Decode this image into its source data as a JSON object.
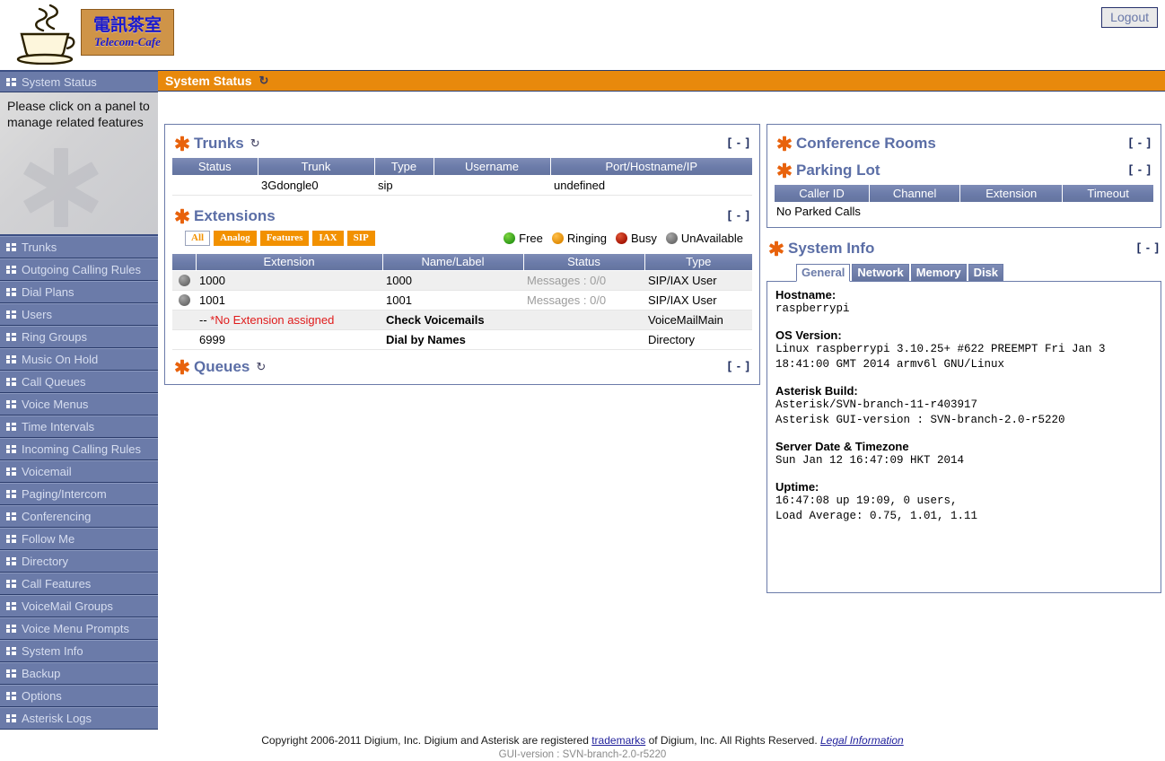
{
  "header": {
    "logo_cn": "電訊茶室",
    "logo_en": "Telecom-Cafe",
    "logo_icon": "coffee-cup-icon",
    "logout_label": "Logout"
  },
  "sidebar": {
    "active_item": "System Status",
    "panel_hint": "Please click on a panel to manage related features",
    "items": [
      {
        "label": "System Status"
      },
      {
        "label": "Trunks"
      },
      {
        "label": "Outgoing Calling Rules"
      },
      {
        "label": "Dial Plans"
      },
      {
        "label": "Users"
      },
      {
        "label": "Ring Groups"
      },
      {
        "label": "Music On Hold"
      },
      {
        "label": "Call Queues"
      },
      {
        "label": "Voice Menus"
      },
      {
        "label": "Time Intervals"
      },
      {
        "label": "Incoming Calling Rules"
      },
      {
        "label": "Voicemail"
      },
      {
        "label": "Paging/Intercom"
      },
      {
        "label": "Conferencing"
      },
      {
        "label": "Follow Me"
      },
      {
        "label": "Directory"
      },
      {
        "label": "Call Features"
      },
      {
        "label": "VoiceMail Groups"
      },
      {
        "label": "Voice Menu Prompts"
      },
      {
        "label": "System Info"
      },
      {
        "label": "Backup"
      },
      {
        "label": "Options"
      },
      {
        "label": "Asterisk Logs"
      }
    ]
  },
  "titlebar": {
    "title": "System Status",
    "refresh_icon": "↻"
  },
  "collapse_label": "[ - ]",
  "trunks": {
    "title": "Trunks",
    "refresh_icon": "↻",
    "columns": [
      "Status",
      "Trunk",
      "Type",
      "Username",
      "Port/Hostname/IP"
    ],
    "rows": [
      {
        "status": "",
        "trunk": "3Gdongle0",
        "type": "sip",
        "username": "",
        "port": "undefined"
      }
    ]
  },
  "extensions": {
    "title": "Extensions",
    "filters": [
      {
        "label": "All",
        "selected": true
      },
      {
        "label": "Analog",
        "selected": false
      },
      {
        "label": "Features",
        "selected": false
      },
      {
        "label": "IAX",
        "selected": false
      },
      {
        "label": "SIP",
        "selected": false
      }
    ],
    "legend": [
      {
        "label": "Free",
        "color": "#2f9a18"
      },
      {
        "label": "Ringing",
        "color": "#e08c06"
      },
      {
        "label": "Busy",
        "color": "#a61505"
      },
      {
        "label": "UnAvailable",
        "color": "#6d6d6d"
      }
    ],
    "columns": [
      "",
      "Extension",
      "Name/Label",
      "Status",
      "Type"
    ],
    "rows": [
      {
        "dot": "gray",
        "extension": "1000",
        "name": "1000",
        "status": "Messages : 0/0",
        "type": "SIP/IAX User"
      },
      {
        "dot": "gray",
        "extension": "1001",
        "name": "1001",
        "status": "Messages : 0/0",
        "type": "SIP/IAX User"
      },
      {
        "dot": "",
        "extension_prefix": "-- ",
        "extension": "*No Extension assigned",
        "name": "Check Voicemails",
        "status": "",
        "type": "VoiceMailMain"
      },
      {
        "dot": "",
        "extension": "6999",
        "name": "Dial by Names",
        "status": "",
        "type": "Directory"
      }
    ]
  },
  "queues": {
    "title": "Queues",
    "refresh_icon": "↻"
  },
  "conference_rooms": {
    "title": "Conference Rooms"
  },
  "parking_lot": {
    "title": "Parking Lot",
    "columns": [
      "Caller ID",
      "Channel",
      "Extension",
      "Timeout"
    ],
    "empty_message": "No Parked Calls"
  },
  "system_info": {
    "title": "System Info",
    "tabs": [
      {
        "label": "General",
        "active": true
      },
      {
        "label": "Network",
        "active": false
      },
      {
        "label": "Memory",
        "active": false
      },
      {
        "label": "Disk",
        "active": false
      }
    ],
    "fields": [
      {
        "label": "Hostname:",
        "value": "raspberrypi"
      },
      {
        "label": "OS Version:",
        "value": "Linux raspberrypi 3.10.25+ #622 PREEMPT Fri Jan 3 18:41:00 GMT 2014 armv6l GNU/Linux"
      },
      {
        "label": "Asterisk Build:",
        "value": "Asterisk/SVN-branch-11-r403917\nAsterisk GUI-version : SVN-branch-2.0-r5220"
      },
      {
        "label": "Server Date & Timezone",
        "value": "Sun Jan 12 16:47:09 HKT 2014"
      },
      {
        "label": "Uptime:",
        "value": "16:47:08 up 19:09, 0 users,\nLoad Average: 0.75, 1.01, 1.11"
      }
    ]
  },
  "footer": {
    "copyright_pre": "Copyright 2006-2011 Digium, Inc. Digium and Asterisk are registered ",
    "trademarks_link": "trademarks",
    "copyright_mid": " of Digium, Inc. All Rights Reserved. ",
    "legal_link": "Legal Information",
    "gui_version": "GUI-version : SVN-branch-2.0-r5220"
  }
}
